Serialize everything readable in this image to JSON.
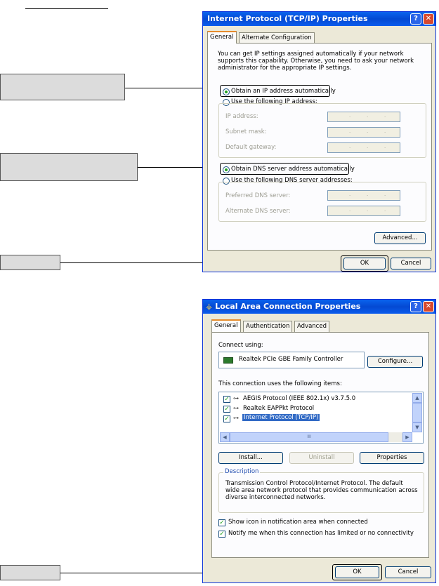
{
  "tcpip": {
    "title": "Internet Protocol (TCP/IP) Properties",
    "help": "?",
    "close": "✕",
    "tabs": [
      "General",
      "Alternate Configuration"
    ],
    "intro": "You can get IP settings assigned automatically if your network supports this capability. Otherwise, you need to ask your network administrator for the appropriate IP settings.",
    "radio_auto_ip": "Obtain an IP address automatically",
    "radio_manual_ip": "Use the following IP address:",
    "ip_label": "IP address:",
    "subnet_label": "Subnet mask:",
    "gateway_label": "Default gateway:",
    "ip_dots": ".",
    "radio_auto_dns": "Obtain DNS server address automatically",
    "radio_manual_dns": "Use the following DNS server addresses:",
    "pref_dns_label": "Preferred DNS server:",
    "alt_dns_label": "Alternate DNS server:",
    "advanced": "Advanced...",
    "ok": "OK",
    "cancel": "Cancel"
  },
  "lac": {
    "title": "Local Area Connection Properties",
    "help": "?",
    "close": "✕",
    "tabs": [
      "General",
      "Authentication",
      "Advanced"
    ],
    "connect_using": "Connect using:",
    "adapter": "Realtek PCIe GBE Family Controller",
    "configure": "Configure...",
    "items_label": "This connection uses the following items:",
    "items": [
      {
        "label": "AEGIS Protocol (IEEE 802.1x) v3.7.5.0",
        "checked": true
      },
      {
        "label": "Realtek EAPPkt Protocol",
        "checked": true
      },
      {
        "label": "Internet Protocol (TCP/IP)",
        "checked": true
      }
    ],
    "install": "Install...",
    "uninstall": "Uninstall",
    "properties": "Properties",
    "desc_legend": "Description",
    "desc_text": "Transmission Control Protocol/Internet Protocol. The default wide area network protocol that provides communication across diverse interconnected networks.",
    "show_icon": "Show icon in notification area when connected",
    "notify": "Notify me when this connection has limited or no connectivity",
    "ok": "OK",
    "cancel": "Cancel",
    "scroll_thumb": "III"
  }
}
